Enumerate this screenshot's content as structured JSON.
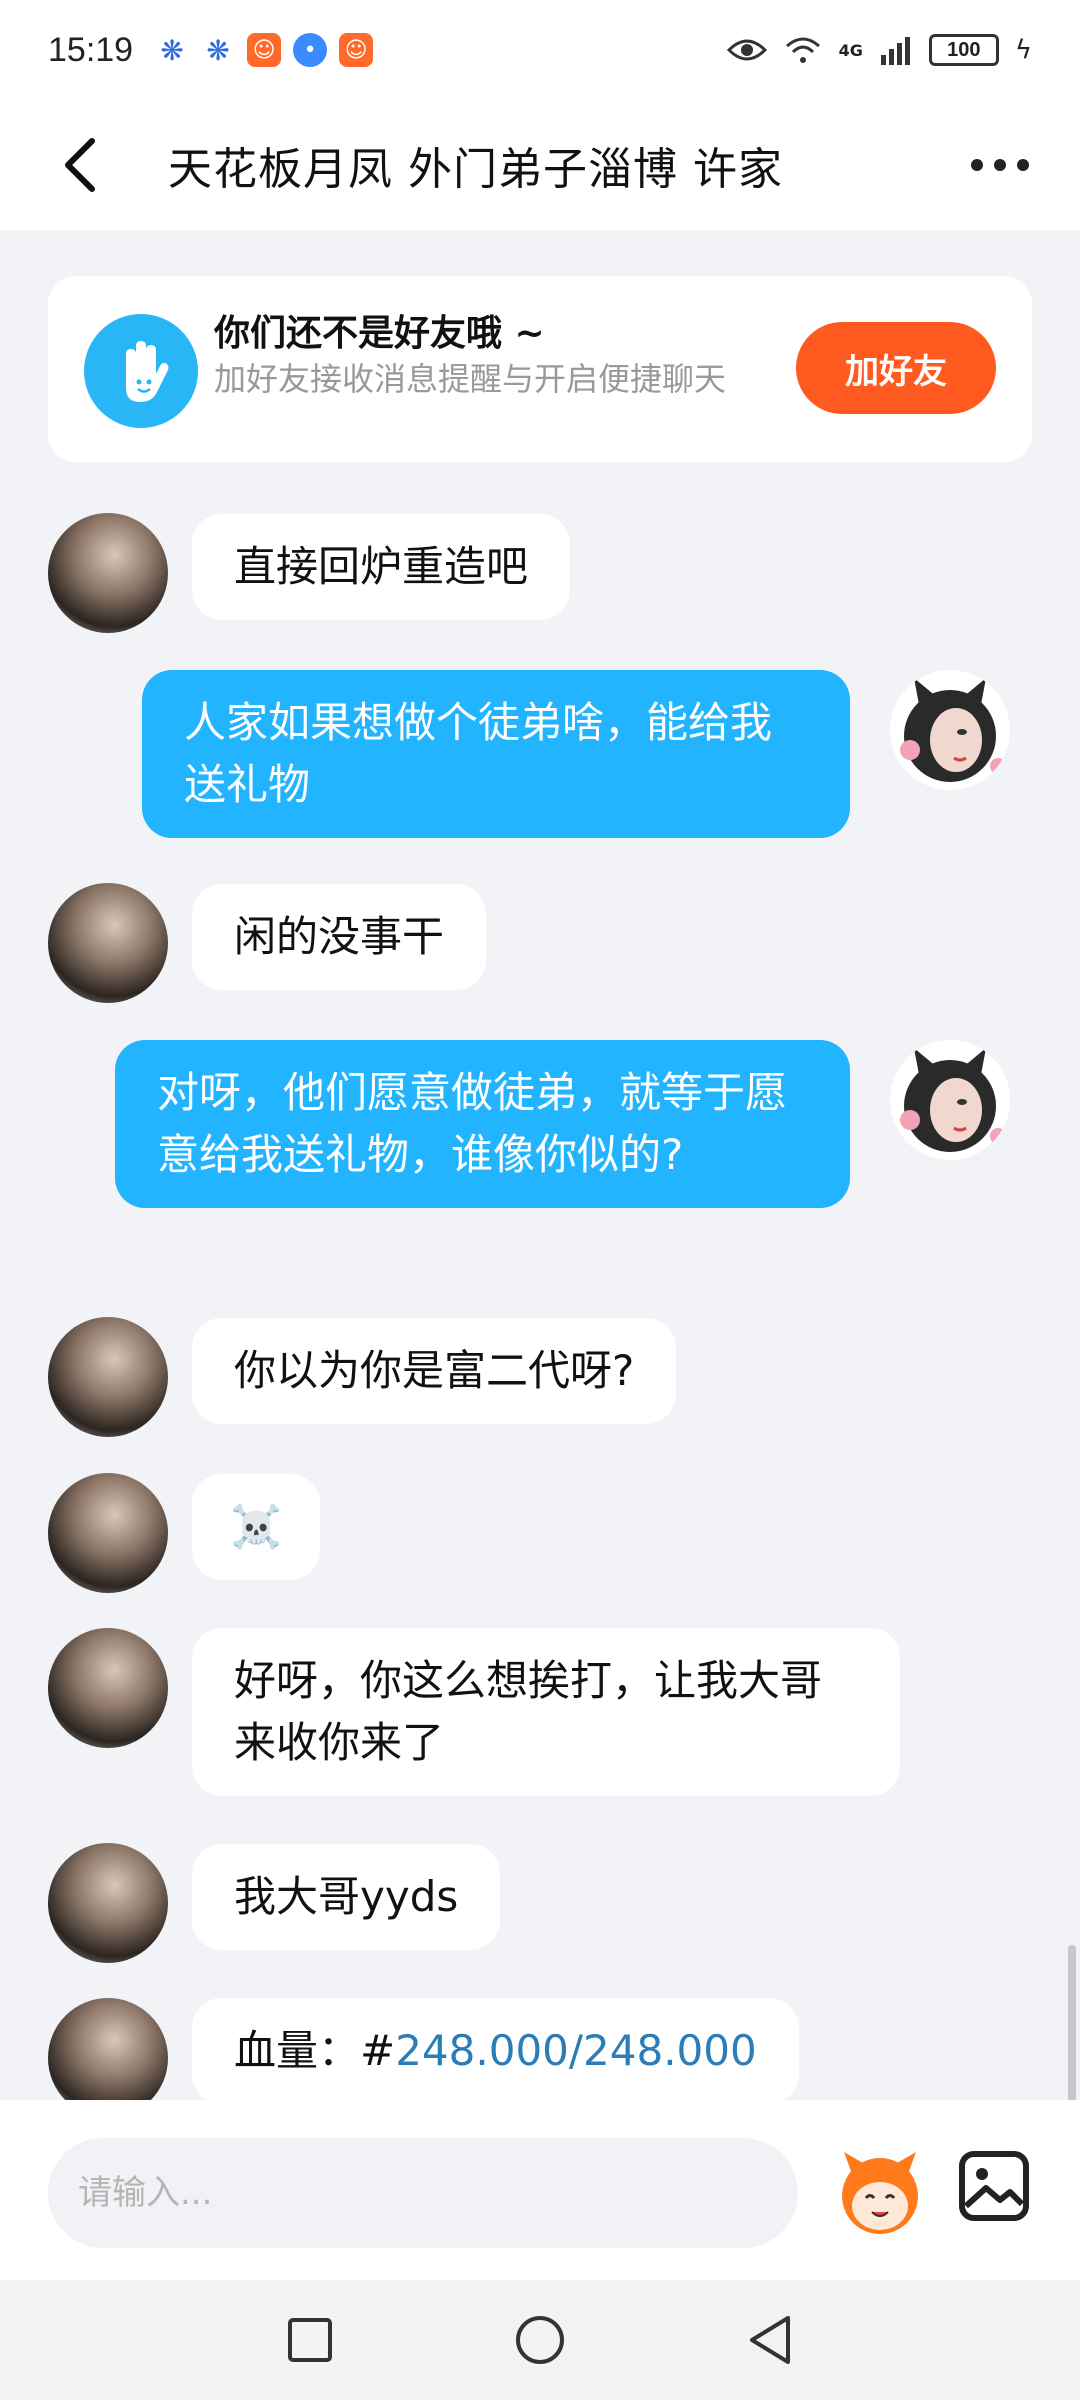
{
  "status_bar": {
    "time": "15:19",
    "network": "4G",
    "battery": "100"
  },
  "header": {
    "title": "天花板月凤 外门弟子淄博 许家"
  },
  "friend_prompt": {
    "title": "你们还不是好友哦 ~",
    "subtitle": "加好友接收消息提醒与开启便捷聊天",
    "button": "加好友"
  },
  "messages": [
    {
      "side": "in",
      "text": "直接回炉重造吧"
    },
    {
      "side": "out",
      "text": "人家如果想做个徒弟啥，能给我送礼物"
    },
    {
      "side": "in",
      "text": "闲的没事干"
    },
    {
      "side": "out",
      "text": "对呀，他们愿意做徒弟，就等于愿意给我送礼物，谁像你似的?"
    },
    {
      "side": "in",
      "text": "你以为你是富二代呀?"
    },
    {
      "side": "in",
      "text": "☠️"
    },
    {
      "side": "in",
      "text": "好呀，你这么想挨打，让我大哥来收你来了"
    },
    {
      "side": "in",
      "text": "我大哥yyds"
    },
    {
      "side": "in",
      "prefix": "血量：#",
      "link": "248.000/248.000"
    }
  ],
  "composer": {
    "placeholder": "请输入..."
  },
  "colors": {
    "outgoing_bubble": "#23b4ff",
    "incoming_bubble": "#ffffff",
    "accent_button": "#ff5a1f",
    "background": "#f1f3f7"
  },
  "icons": [
    "back-arrow-icon",
    "more-dots-icon",
    "wave-hand-icon",
    "emoji-face-icon",
    "image-icon",
    "recent-apps-icon",
    "home-icon",
    "back-nav-icon"
  ]
}
